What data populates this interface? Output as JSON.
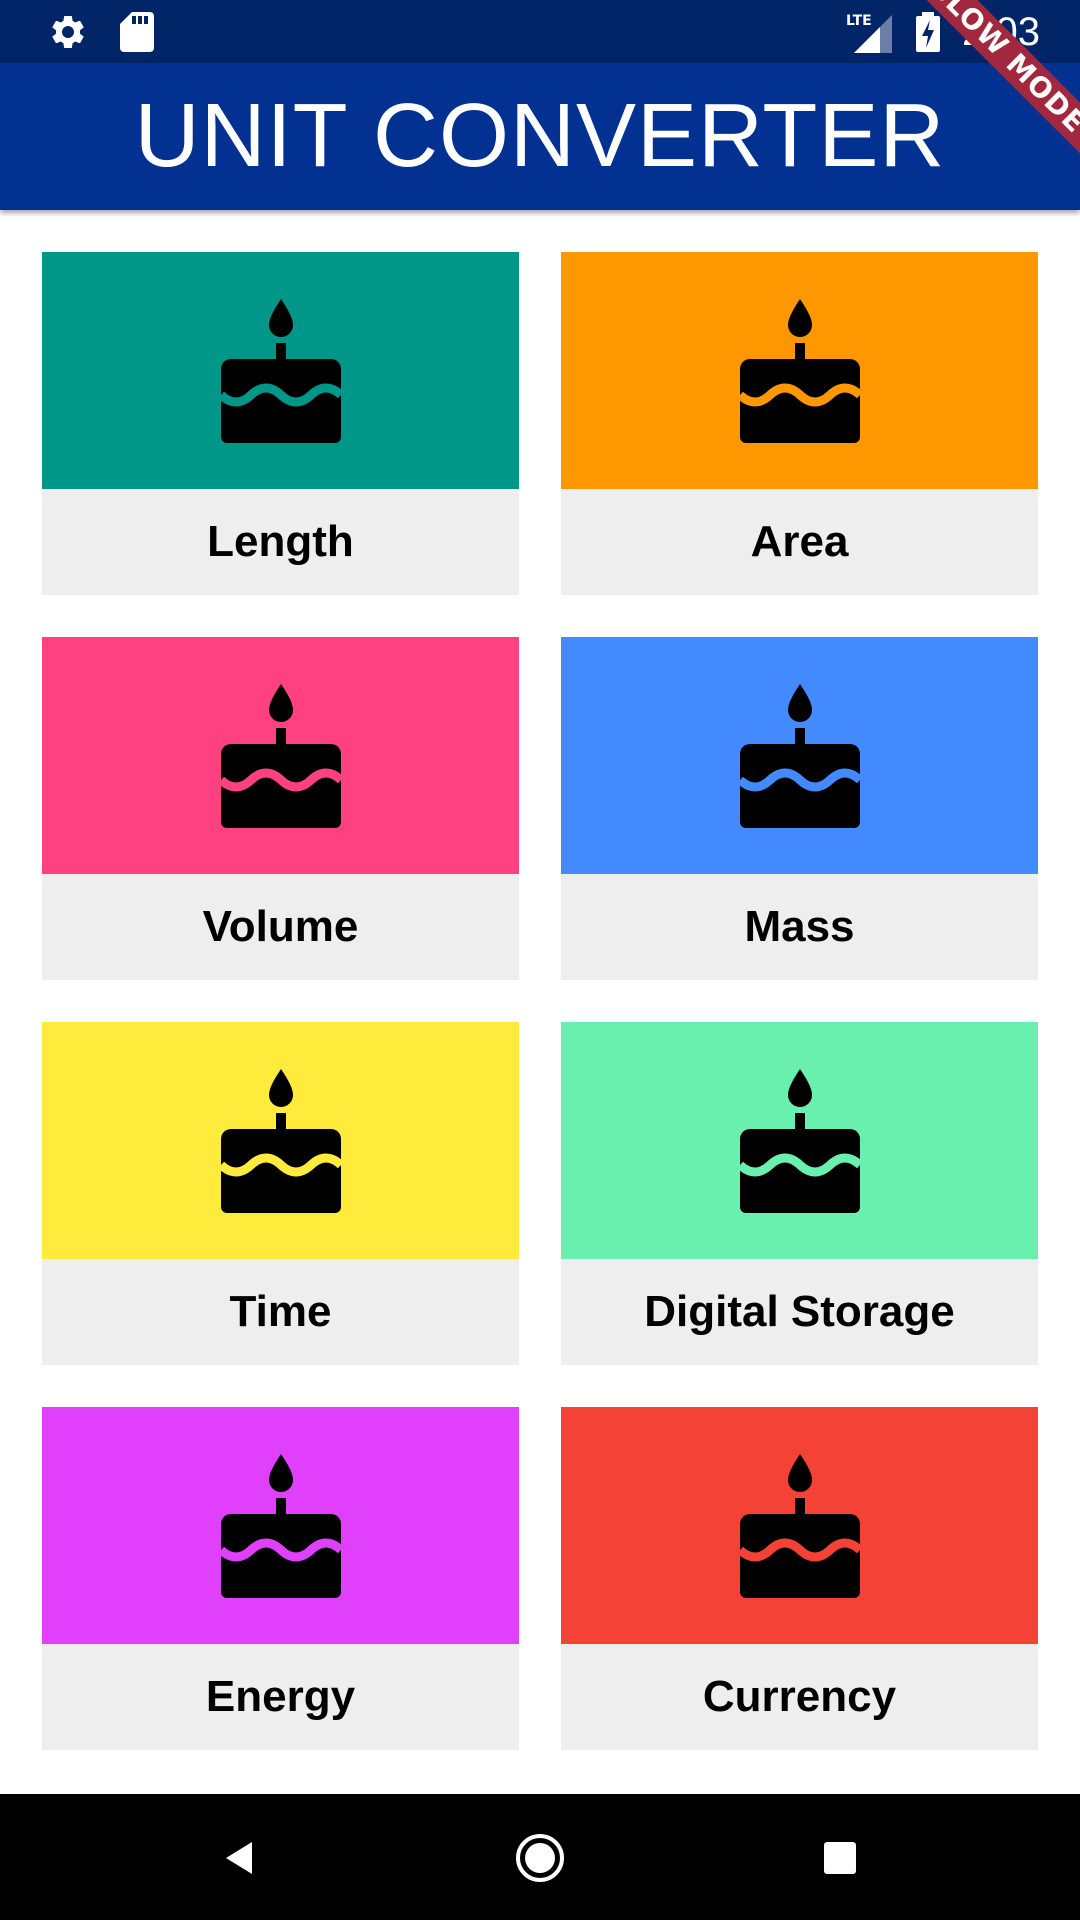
{
  "status_bar": {
    "time": "2:03",
    "network": "LTE",
    "icons": [
      "settings-icon",
      "sd-card-icon",
      "signal-icon",
      "battery-charging-icon"
    ]
  },
  "app_bar": {
    "title": "UNIT CONVERTER"
  },
  "debug_banner": {
    "label": "SLOW MODE"
  },
  "categories": [
    {
      "label": "Length",
      "color": "#009688",
      "icon": "cake-icon"
    },
    {
      "label": "Area",
      "color": "#ff9800",
      "icon": "cake-icon"
    },
    {
      "label": "Volume",
      "color": "#ff4081",
      "icon": "cake-icon"
    },
    {
      "label": "Mass",
      "color": "#448aff",
      "icon": "cake-icon"
    },
    {
      "label": "Time",
      "color": "#ffeb3b",
      "icon": "cake-icon"
    },
    {
      "label": "Digital Storage",
      "color": "#69f0ae",
      "icon": "cake-icon"
    },
    {
      "label": "Energy",
      "color": "#e040fb",
      "icon": "cake-icon"
    },
    {
      "label": "Currency",
      "color": "#f44336",
      "icon": "cake-icon"
    }
  ],
  "nav_bar": {
    "buttons": [
      "back-icon",
      "home-icon",
      "recents-icon"
    ]
  }
}
